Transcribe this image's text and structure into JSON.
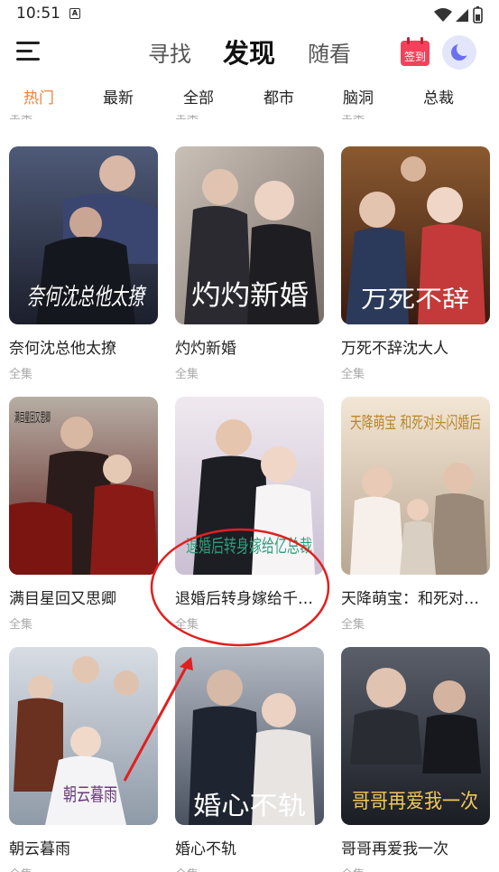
{
  "status_bar": {
    "time": "10:51",
    "notif_glyph": "A"
  },
  "nav": {
    "tabs": [
      {
        "label": "寻找"
      },
      {
        "label": "发现"
      },
      {
        "label": "随看"
      }
    ],
    "active_tab": "发现",
    "checkin_label": "签到"
  },
  "categories": {
    "items": [
      "热门",
      "最新",
      "全部",
      "都市",
      "脑洞",
      "总裁"
    ],
    "active": "热门",
    "accent_color": "#f2803a"
  },
  "prev_row_sub": "全集",
  "dramas": [
    {
      "title": "奈何沈总他太撩",
      "sub": "全集",
      "cover_text": "奈何沈总他太撩"
    },
    {
      "title": "灼灼新婚",
      "sub": "全集",
      "cover_text": "灼灼新婚"
    },
    {
      "title": "万死不辞沈大人",
      "sub": "全集",
      "cover_text": "万死不辞"
    },
    {
      "title": "满目星回又思卿",
      "sub": "全集",
      "cover_text": "满目星回又思卿"
    },
    {
      "title": "退婚后转身嫁给千…",
      "sub": "全集",
      "cover_text": "退婚后转身嫁给亿总裁"
    },
    {
      "title": "天降萌宝：和死对…",
      "sub": "全集",
      "cover_text": "天降萌宝 和死对头闪婚后"
    },
    {
      "title": "朝云暮雨",
      "sub": "全集",
      "cover_text": "朝云暮雨"
    },
    {
      "title": "婚心不轨",
      "sub": "全集",
      "cover_text": "婚心不轨"
    },
    {
      "title": "哥哥再爱我一次",
      "sub": "全集",
      "cover_text": "哥哥再爱我一次"
    }
  ],
  "annotation": {
    "color": "#e02020",
    "shape": "circle-and-arrow",
    "target": "退婚后转身嫁给千…"
  }
}
